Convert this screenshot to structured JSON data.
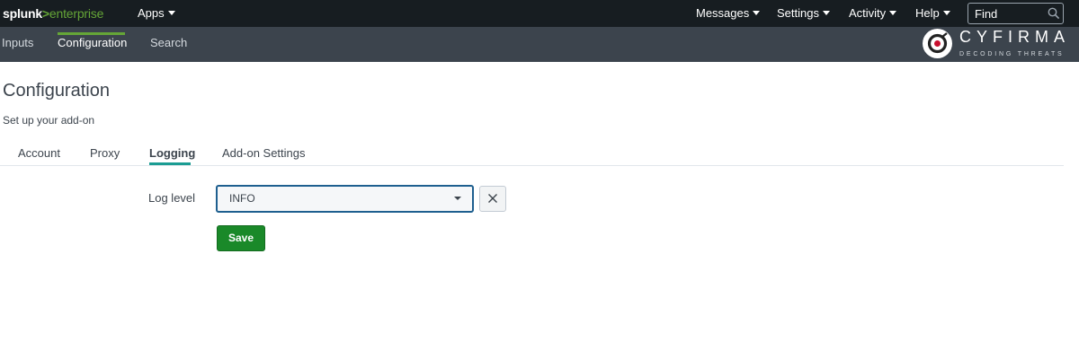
{
  "topbar": {
    "logo_part1": "splunk",
    "logo_part2": ">",
    "logo_part3": "enterprise",
    "apps_label": "Apps",
    "messages_label": "Messages",
    "settings_label": "Settings",
    "activity_label": "Activity",
    "help_label": "Help",
    "find_label": "Find"
  },
  "appbar": {
    "nav_items": [
      "Inputs",
      "Configuration",
      "Search"
    ],
    "active_index": 1,
    "brand_name": "CYFIRMA",
    "brand_tagline": "DECODING THREATS"
  },
  "page": {
    "title": "Configuration",
    "subtitle": "Set up your add-on",
    "tabs": [
      "Account",
      "Proxy",
      "Logging",
      "Add-on Settings"
    ],
    "active_tab": "Logging"
  },
  "form": {
    "log_level_label": "Log level",
    "log_level_value": "INFO",
    "save_label": "Save"
  },
  "icons": {
    "find": "search-icon",
    "clear": "close-icon",
    "dropdown": "caret-down-icon",
    "brand": "cyfirma-logo-icon"
  },
  "colors": {
    "topbar_bg": "#171d21",
    "appbar_bg": "#3c444d",
    "brand_green": "#65a637",
    "save_green": "#1a8929",
    "tab_accent": "#1a9c93",
    "select_border": "#1e5f8f"
  }
}
